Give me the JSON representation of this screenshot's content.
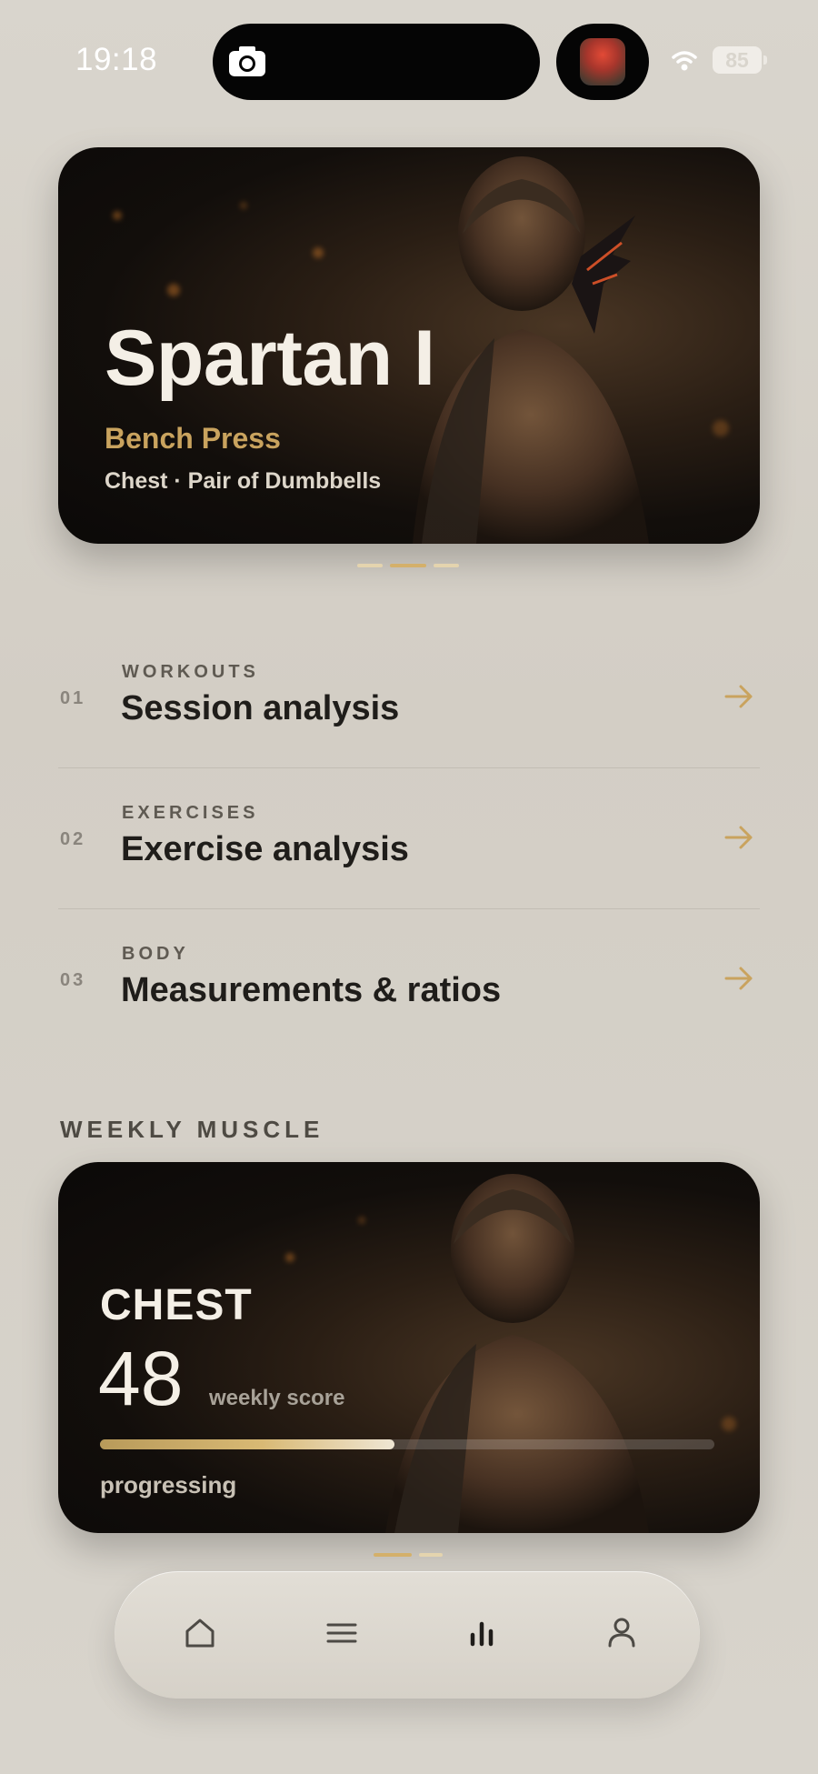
{
  "status_bar": {
    "time": "19:18",
    "battery": "85"
  },
  "hero": {
    "title": "Spartan I",
    "exercise": "Bench Press",
    "meta": "Chest · Pair of Dumbbells"
  },
  "analysis": [
    {
      "num": "01",
      "category": "WORKOUTS",
      "title": "Session analysis"
    },
    {
      "num": "02",
      "category": "EXERCISES",
      "title": "Exercise analysis"
    },
    {
      "num": "03",
      "category": "BODY",
      "title": "Measurements & ratios"
    }
  ],
  "weekly_muscle": {
    "section_label": "WEEKLY MUSCLE",
    "muscle": "CHEST",
    "score": "48",
    "score_label": "weekly score",
    "progress": 0.48,
    "status": "progressing"
  },
  "tabbar": {
    "items": [
      {
        "icon": "home-icon"
      },
      {
        "icon": "list-icon"
      },
      {
        "icon": "chart-icon"
      },
      {
        "icon": "profile-icon"
      }
    ],
    "active_index": 2
  },
  "colors": {
    "accent": "#c9a35e",
    "card_dark": "#0b0908"
  }
}
